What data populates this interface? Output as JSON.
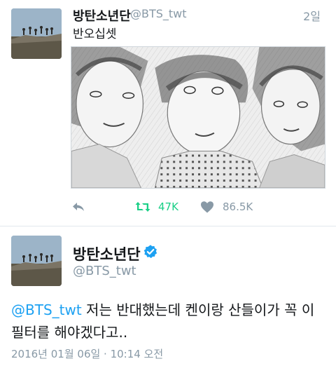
{
  "tweet": {
    "author_name": "방탄소년단",
    "handle": "@BTS_twt",
    "time": "2일",
    "text": "반오십셋",
    "media": {
      "kind": "photo",
      "style": "pencil-sketch",
      "subjects": 3
    },
    "actions": {
      "reply": {
        "icon": "reply-icon"
      },
      "retweet": {
        "icon": "retweet-icon",
        "count": "47K",
        "active": true,
        "color": "#19cf86"
      },
      "like": {
        "icon": "heart-icon",
        "count": "86.5K",
        "active": false
      }
    }
  },
  "detail_tweet": {
    "author_name": "방탄소년단",
    "verified": true,
    "handle": "@BTS_twt",
    "mention": "@BTS_twt",
    "text_after_mention": " 저는 반대했는데 켄이랑 산들이가 꼭 이 필터를 해야겠다고..",
    "timestamp": "2016년 01월 06일 · 10:14 오전"
  },
  "colors": {
    "link": "#1da1f2",
    "secondary_text": "#8899a6",
    "retweet_active": "#19cf86",
    "divider": "#e1e8ed"
  }
}
